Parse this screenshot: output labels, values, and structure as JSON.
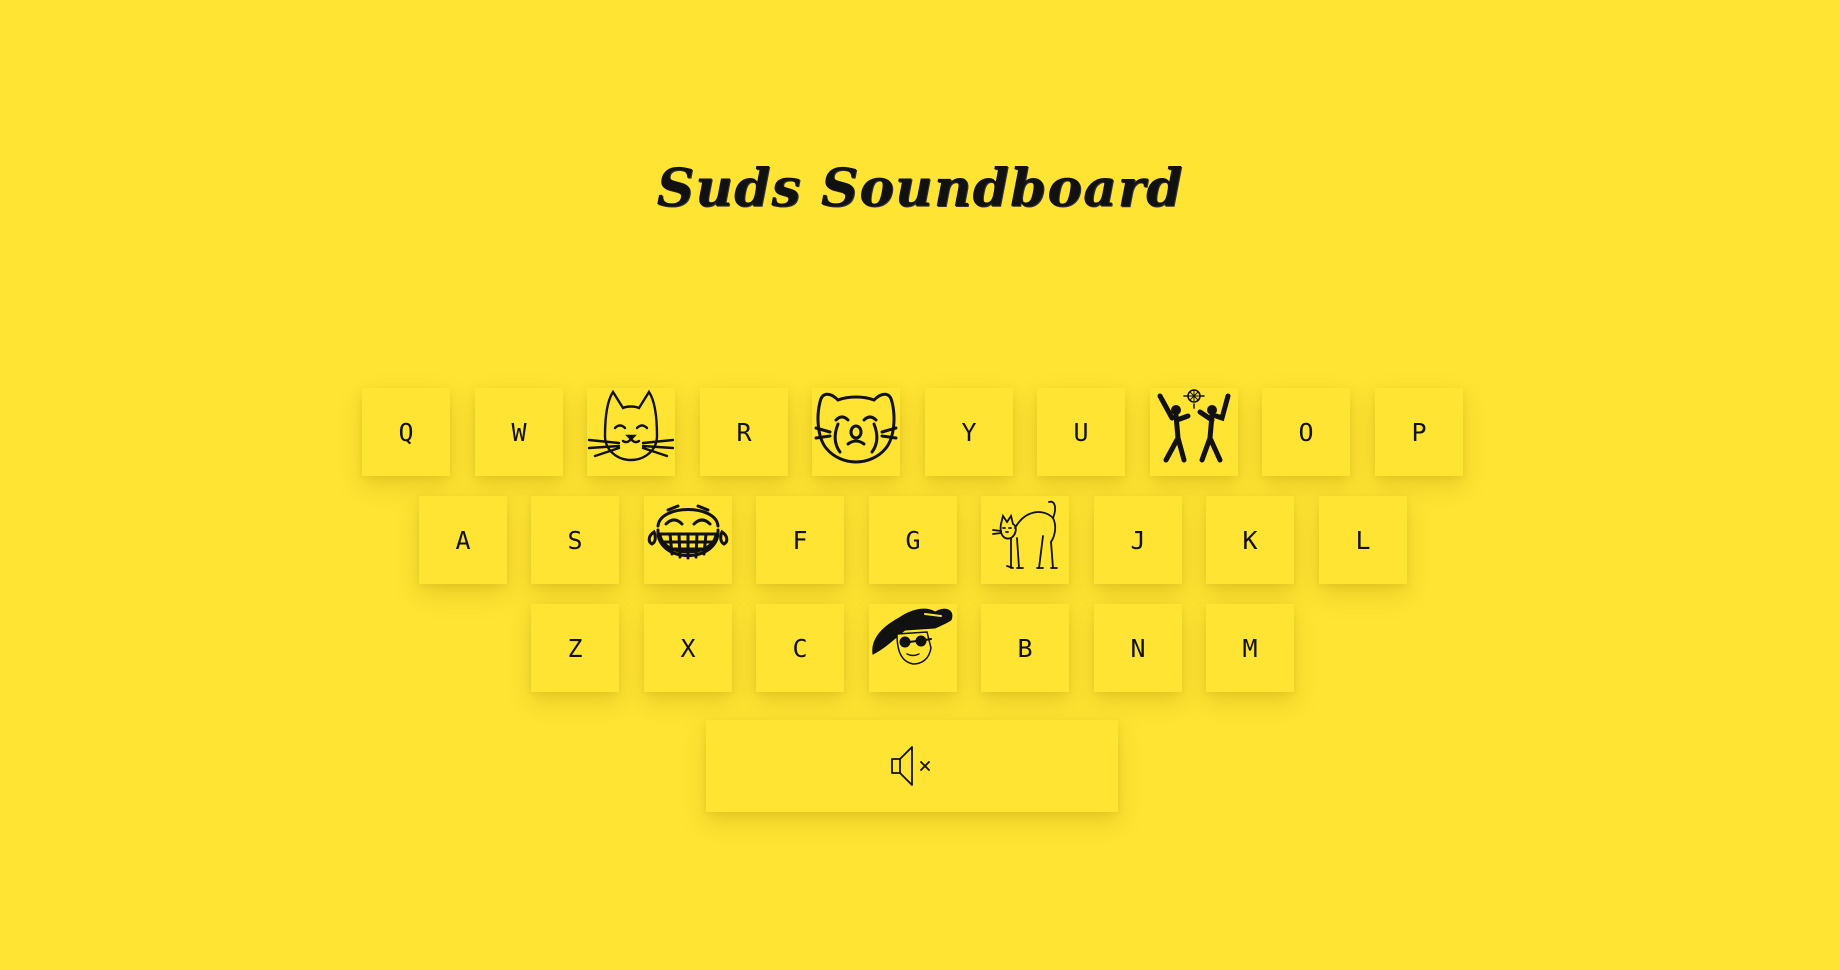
{
  "title": "Suds Soundboard",
  "keyboard": {
    "row1": {
      "q": "Q",
      "w": "W",
      "e_icon": "cat-face-icon",
      "r": "R",
      "t_icon": "crying-cat-face-icon",
      "y": "Y",
      "u": "U",
      "i_icon": "dancing-people-disco-ball-icon",
      "o": "O",
      "p": "P"
    },
    "row2": {
      "a": "A",
      "s": "S",
      "d_icon": "laughing-tears-face-icon",
      "f": "F",
      "g": "G",
      "h_icon": "startled-cat-icon",
      "j": "J",
      "k": "K",
      "l": "L"
    },
    "row3": {
      "z": "Z",
      "x": "X",
      "c": "C",
      "v_icon": "person-with-hat-sunglasses-icon",
      "b": "B",
      "n": "N",
      "m": "M"
    },
    "mute_icon": "speaker-muted-icon"
  },
  "colors": {
    "background": "#ffe433",
    "text": "#111111"
  }
}
